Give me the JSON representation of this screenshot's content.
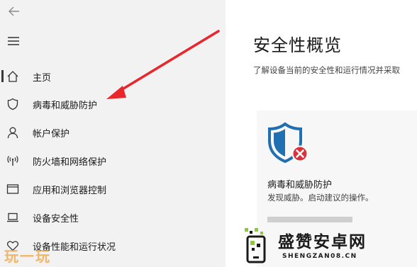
{
  "main": {
    "title": "安全性概览",
    "subtitle": "了解设备当前的安全性和运行情况并采取",
    "card": {
      "title": "病毒和威胁防护",
      "description": "发现威胁。启动建议的操作。",
      "icon": "shield-error-icon",
      "accent": "#1f6fb2",
      "alert_color": "#d9323a"
    }
  },
  "sidebar": {
    "back_icon": "back-arrow-icon",
    "menu_icon": "hamburger-icon",
    "items": [
      {
        "label": "主页",
        "icon": "home-icon",
        "selected": true
      },
      {
        "label": "病毒和威胁防护",
        "icon": "shield-icon"
      },
      {
        "label": "帐户保护",
        "icon": "person-icon"
      },
      {
        "label": "防火墙和网络保护",
        "icon": "wifi-antenna-icon"
      },
      {
        "label": "应用和浏览器控制",
        "icon": "app-window-icon"
      },
      {
        "label": "设备安全性",
        "icon": "laptop-icon"
      },
      {
        "label": "设备性能和运行状况",
        "icon": "heart-icon"
      }
    ]
  },
  "annotation": {
    "arrow_color": "#e8262c"
  },
  "watermark": {
    "left_text": "玩一玩",
    "brand": "盛赞安卓网",
    "url": "SHENGZAN08.CN"
  }
}
